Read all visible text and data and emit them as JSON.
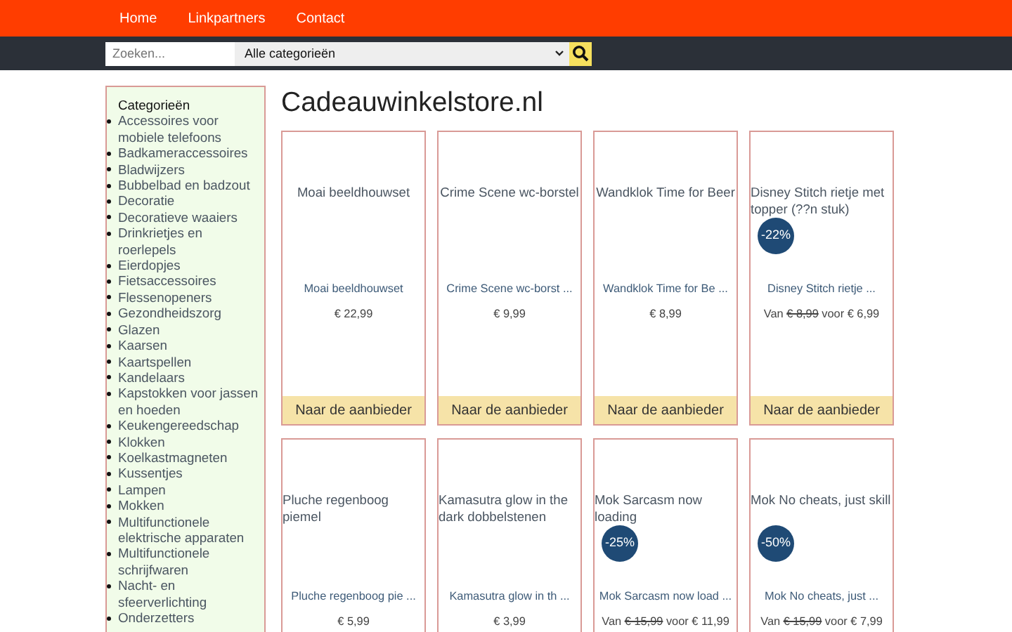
{
  "nav": {
    "links": [
      "Home",
      "Linkpartners",
      "Contact"
    ]
  },
  "search": {
    "placeholder": "Zoeken...",
    "category": "Alle categorieën"
  },
  "sidebar": {
    "title": "Categorieën",
    "items": [
      "Accessoires voor mobiele telefoons",
      "Badkameraccessoires",
      "Bladwijzers",
      "Bubbelbad en badzout",
      "Decoratie",
      "Decoratieve waaiers",
      "Drinkrietjes en roerlepels",
      "Eierdopjes",
      "Fietsaccessoires",
      "Flessenopeners",
      "Gezondheidszorg",
      "Glazen",
      "Kaarsen",
      "Kaartspellen",
      "Kandelaars",
      "Kapstokken voor jassen en hoeden",
      "Keukengereedschap",
      "Klokken",
      "Koelkastmagneten",
      "Kussentjes",
      "Lampen",
      "Mokken",
      "Multifunctionele elektrische apparaten",
      "Multifunctionele schrijfwaren",
      "Nacht- en sfeerverlichting",
      "Onderzetters"
    ]
  },
  "title": "Cadeauwinkelstore.nl",
  "products": [
    {
      "kind": "regular",
      "image_alt": "Moai beeldhouwset",
      "name": "Moai beeldhouwset",
      "price": "€ 22,99",
      "button": "Naar de aanbieder"
    },
    {
      "kind": "regular",
      "image_alt": "Crime Scene wc-borstel",
      "name": "Crime Scene wc-borst ...",
      "price": "€ 9,99",
      "button": "Naar de aanbieder"
    },
    {
      "kind": "regular",
      "image_alt": "Wandklok Time for Beer",
      "name": "Wandklok Time for Be ...",
      "price": "€ 8,99",
      "button": "Naar de aanbieder"
    },
    {
      "kind": "sale",
      "image_alt": "Disney Stitch rietje met topper (??n stuk)",
      "badge": "-22%",
      "name": "Disney Stitch rietje ...",
      "price_prefix": "Van",
      "old_price": "€ 8,99",
      "price_joiner": "voor",
      "price": "€ 6,99",
      "button": "Naar de aanbieder"
    },
    {
      "kind": "regular",
      "image_alt": "Pluche regenboog piemel",
      "name": "Pluche regenboog pie ...",
      "price": "€ 5,99"
    },
    {
      "kind": "regular",
      "image_alt": "Kamasutra glow in the dark dobbelstenen",
      "name": "Kamasutra glow in th ...",
      "price": "€ 3,99"
    },
    {
      "kind": "sale",
      "image_alt": "Mok Sarcasm now loading",
      "badge": "-25%",
      "name": "Mok Sarcasm now load ...",
      "price_prefix": "Van",
      "old_price": "€ 15,99",
      "price_joiner": "voor",
      "price": "€ 11,99"
    },
    {
      "kind": "sale",
      "image_alt": "Mok No cheats, just skill",
      "badge": "-50%",
      "name": "Mok No cheats, just ...",
      "price_prefix": "Van",
      "old_price": "€ 15,99",
      "price_joiner": "voor",
      "price": "€ 7,99"
    }
  ]
}
